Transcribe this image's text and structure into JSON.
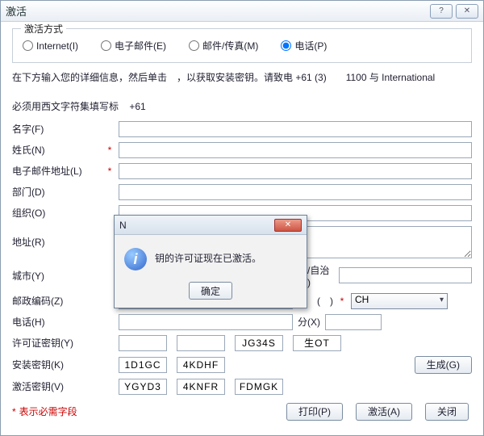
{
  "window": {
    "title": "激活",
    "help": "?",
    "close": "✕"
  },
  "method": {
    "legend": "激活方式",
    "options": {
      "internet": "Internet(I)",
      "email": "电子邮件(E)",
      "fax": "邮件/传真(M)",
      "phone": "电话(P)"
    }
  },
  "instr": "在下方输入您的详细信息，然后单击　，以获取安装密钥。请致电  +61 (3)　　1100 与  International",
  "note": {
    "label": "必须用西文字符集填写标",
    "phone": "+61"
  },
  "form": {
    "firstName": "名字(F)",
    "lastName": "姓氏(N)",
    "email": "电子邮件地址(L)",
    "dept": "部门(D)",
    "org": "组织(O)",
    "addr": "地址(R)",
    "city": "城市(Y)",
    "state": "州/自治(Y)",
    "zip": "邮政编码(Z)",
    "region": "地　(　)",
    "regionValue": "CH",
    "phone": "电话(H)",
    "ext": "分(X)",
    "license": "许可证密钥(Y)",
    "licenseSeg": {
      "a": "",
      "b": "",
      "c": "JG34S",
      "d": "生OT"
    },
    "install": "安装密钥(K)",
    "installSeg": {
      "a": "1D1GC",
      "b": "4KDHF"
    },
    "genBtn": "生成(G)",
    "activ": "激活密钥(V)",
    "activSeg": {
      "a": "YGYD3",
      "b": "4KNFR",
      "c": "FDMGK"
    }
  },
  "footer": {
    "reqText": "表示必需字段",
    "print": "打印(P)",
    "activate": "激活(A)",
    "close": "关闭"
  },
  "dialog": {
    "title": "N",
    "msg": "钥的许可证现在已激活。",
    "ok": "确定",
    "close": "✕"
  }
}
